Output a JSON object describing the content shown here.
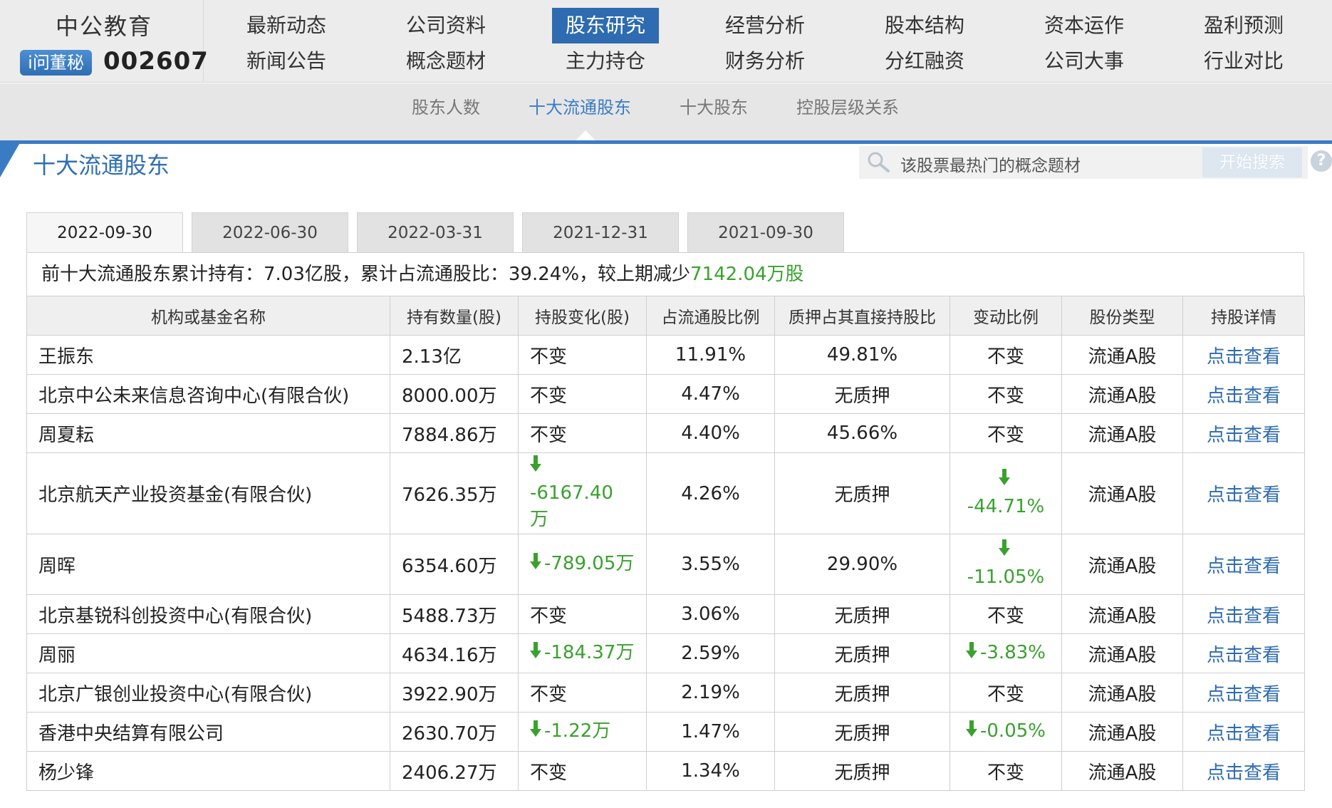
{
  "brand": {
    "name": "中公教育",
    "badge": "i问董秘",
    "code": "002607"
  },
  "nav": {
    "row1": [
      "最新动态",
      "公司资料",
      "股东研究",
      "经营分析",
      "股本结构",
      "资本运作",
      "盈利预测"
    ],
    "row2": [
      "新闻公告",
      "概念题材",
      "主力持仓",
      "财务分析",
      "分红融资",
      "公司大事",
      "行业对比"
    ],
    "active": "股东研究"
  },
  "subnav": {
    "items": [
      "股东人数",
      "十大流通股东",
      "十大股东",
      "控股层级关系"
    ],
    "active": "十大流通股东"
  },
  "section": {
    "title": "十大流通股东"
  },
  "search": {
    "placeholder": "该股票最热门的概念题材",
    "button": "开始搜索",
    "help": "?"
  },
  "tabs": {
    "dates": [
      "2022-09-30",
      "2022-06-30",
      "2022-03-31",
      "2021-12-31",
      "2021-09-30"
    ],
    "active": "2022-09-30"
  },
  "summary": {
    "prefix": "前十大流通股东累计持有：7.03亿股，累计占流通股比：39.24%，较上期减少",
    "decrease": "7142.04万股"
  },
  "table": {
    "headers": [
      "机构或基金名称",
      "持有数量(股)",
      "持股变化(股)",
      "占流通股比例",
      "质押占其直接持股比",
      "变动比例",
      "股份类型",
      "持股详情"
    ],
    "rows": [
      {
        "name": "王振东",
        "qty": "2.13亿",
        "change": "不变",
        "change_down": false,
        "pct": "11.91%",
        "pledge": "49.81%",
        "ratio": "不变",
        "ratio_down": false,
        "type": "流通A股",
        "detail": "点击查看"
      },
      {
        "name": "北京中公未来信息咨询中心(有限合伙)",
        "qty": "8000.00万",
        "change": "不变",
        "change_down": false,
        "pct": "4.47%",
        "pledge": "无质押",
        "ratio": "不变",
        "ratio_down": false,
        "type": "流通A股",
        "detail": "点击查看"
      },
      {
        "name": "周夏耘",
        "qty": "7884.86万",
        "change": "不变",
        "change_down": false,
        "pct": "4.40%",
        "pledge": "45.66%",
        "ratio": "不变",
        "ratio_down": false,
        "type": "流通A股",
        "detail": "点击查看"
      },
      {
        "name": "北京航天产业投资基金(有限合伙)",
        "qty": "7626.35万",
        "change": "-6167.40万",
        "change_down": true,
        "pct": "4.26%",
        "pledge": "无质押",
        "ratio": "-44.71%",
        "ratio_down": true,
        "type": "流通A股",
        "detail": "点击查看"
      },
      {
        "name": "周晖",
        "qty": "6354.60万",
        "change": "-789.05万",
        "change_down": true,
        "pct": "3.55%",
        "pledge": "29.90%",
        "ratio": "-11.05%",
        "ratio_down": true,
        "type": "流通A股",
        "detail": "点击查看"
      },
      {
        "name": "北京基锐科创投资中心(有限合伙)",
        "qty": "5488.73万",
        "change": "不变",
        "change_down": false,
        "pct": "3.06%",
        "pledge": "无质押",
        "ratio": "不变",
        "ratio_down": false,
        "type": "流通A股",
        "detail": "点击查看"
      },
      {
        "name": "周丽",
        "qty": "4634.16万",
        "change": "-184.37万",
        "change_down": true,
        "pct": "2.59%",
        "pledge": "无质押",
        "ratio": "-3.83%",
        "ratio_down": true,
        "type": "流通A股",
        "detail": "点击查看"
      },
      {
        "name": "北京广银创业投资中心(有限合伙)",
        "qty": "3922.90万",
        "change": "不变",
        "change_down": false,
        "pct": "2.19%",
        "pledge": "无质押",
        "ratio": "不变",
        "ratio_down": false,
        "type": "流通A股",
        "detail": "点击查看"
      },
      {
        "name": "香港中央结算有限公司",
        "qty": "2630.70万",
        "change": "-1.22万",
        "change_down": true,
        "pct": "1.47%",
        "pledge": "无质押",
        "ratio": "-0.05%",
        "ratio_down": true,
        "type": "流通A股",
        "detail": "点击查看"
      },
      {
        "name": "杨少锋",
        "qty": "2406.27万",
        "change": "不变",
        "change_down": false,
        "pct": "1.34%",
        "pledge": "无质押",
        "ratio": "不变",
        "ratio_down": false,
        "type": "流通A股",
        "detail": "点击查看"
      }
    ]
  },
  "colors": {
    "accent": "#2e6bb0",
    "down": "#3aa12e"
  }
}
